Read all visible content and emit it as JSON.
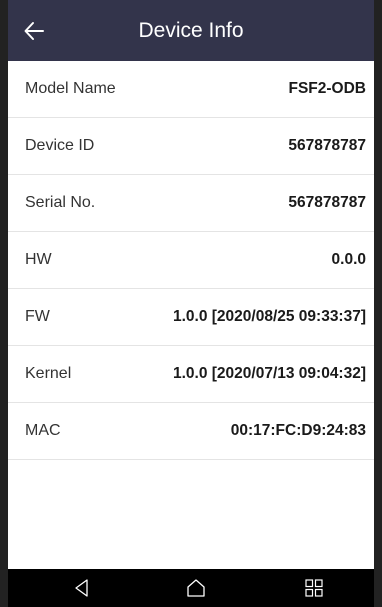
{
  "header": {
    "title": "Device Info"
  },
  "rows": [
    {
      "label": "Model Name",
      "value": "FSF2-ODB"
    },
    {
      "label": "Device ID",
      "value": "567878787"
    },
    {
      "label": "Serial No.",
      "value": "567878787"
    },
    {
      "label": "HW",
      "value": "0.0.0"
    },
    {
      "label": "FW",
      "value": "1.0.0 [2020/08/25 09:33:37]"
    },
    {
      "label": "Kernel",
      "value": "1.0.0 [2020/07/13 09:04:32]"
    },
    {
      "label": "MAC",
      "value": "00:17:FC:D9:24:83"
    }
  ],
  "icons": {
    "back": "arrow-left-icon",
    "nav_back": "triangle-back-icon",
    "nav_home": "home-icon",
    "nav_recent": "recent-apps-grid-icon"
  },
  "colors": {
    "appbar": "#33344b",
    "navbar": "#000000",
    "divider": "#e4e4e4"
  }
}
